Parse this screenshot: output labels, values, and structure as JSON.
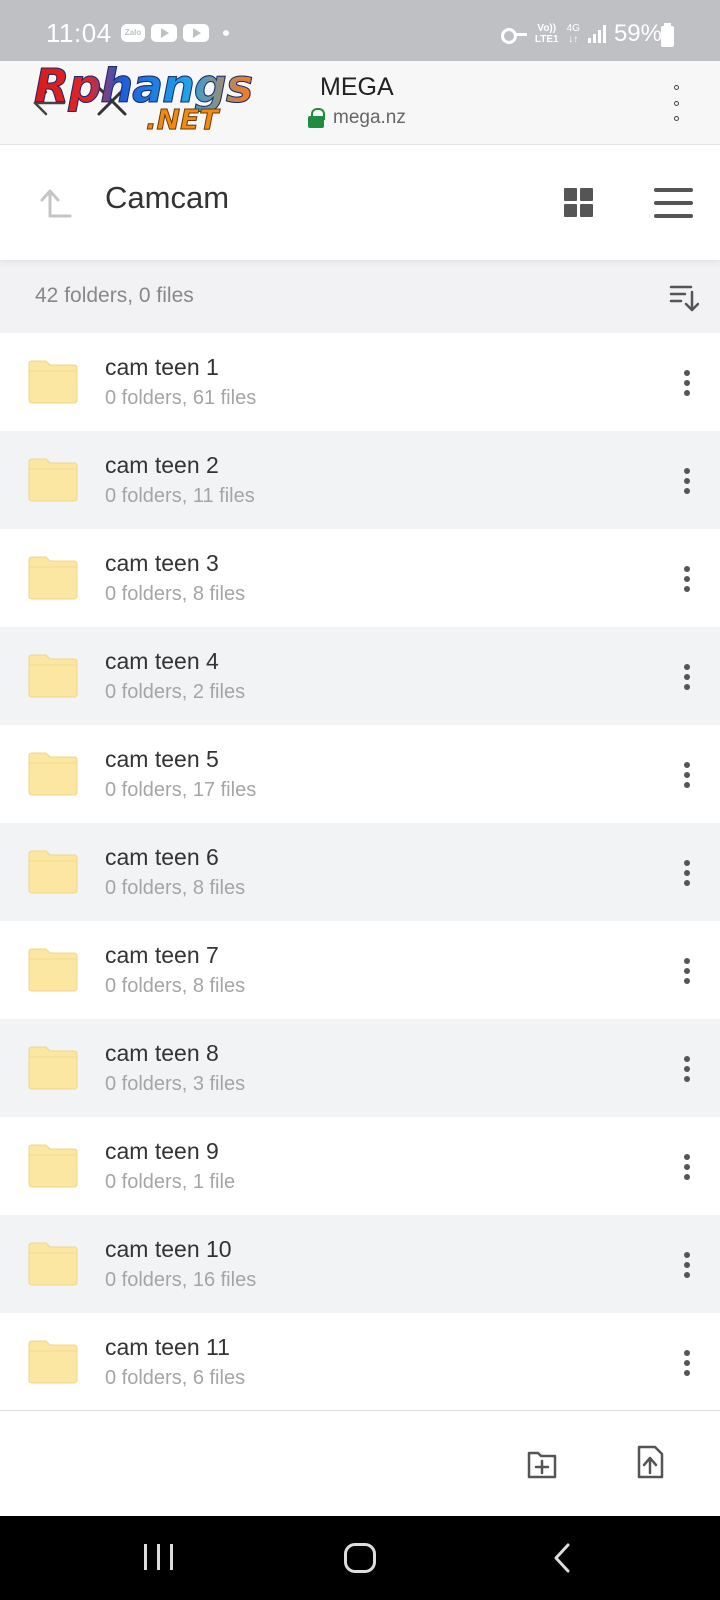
{
  "status_bar": {
    "time": "11:04",
    "notification_apps": [
      "Zalo",
      "youtube-icon",
      "youtube-icon"
    ],
    "volte_label_top": "Vo))",
    "volte_label_bottom": "LTE1",
    "network_label": "4G",
    "battery": "59%"
  },
  "browser": {
    "watermark_main": "Rphangs",
    "watermark_sub": ".NET",
    "site_title": "MEGA",
    "site_url": "mega.nz"
  },
  "folder": {
    "title": "Camcam",
    "summary": "42 folders, 0 files"
  },
  "items": [
    {
      "name": "cam teen 1",
      "meta": "0 folders, 61 files"
    },
    {
      "name": "cam teen 2",
      "meta": "0 folders, 11 files"
    },
    {
      "name": "cam teen 3",
      "meta": "0 folders, 8 files"
    },
    {
      "name": "cam teen 4",
      "meta": "0 folders, 2 files"
    },
    {
      "name": "cam teen 5",
      "meta": "0 folders, 17 files"
    },
    {
      "name": "cam teen 6",
      "meta": "0 folders, 8 files"
    },
    {
      "name": "cam teen 7",
      "meta": "0 folders, 8 files"
    },
    {
      "name": "cam teen 8",
      "meta": "0 folders, 3 files"
    },
    {
      "name": "cam teen 9",
      "meta": "0 folders, 1 file"
    },
    {
      "name": "cam teen 10",
      "meta": "0 folders, 16 files"
    },
    {
      "name": "cam teen 11",
      "meta": "0 folders, 6 files"
    }
  ],
  "colors": {
    "folder_fill": "#fbe6a2",
    "lock_green": "#1e8e3e",
    "status_bar": "#bfc0c3"
  }
}
